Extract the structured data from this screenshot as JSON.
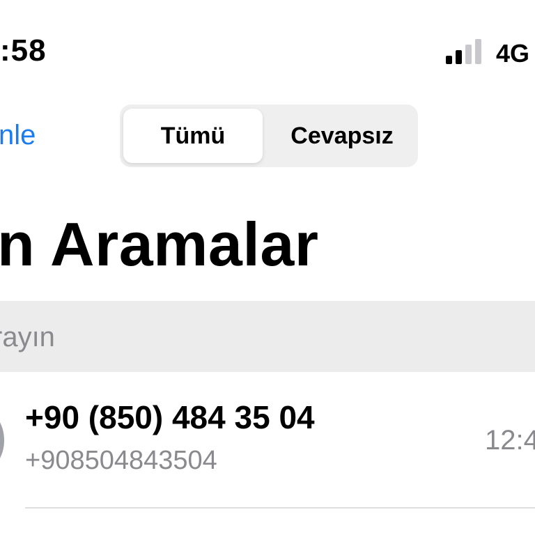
{
  "status_bar": {
    "time": ":58",
    "network": "4G",
    "signal_bars_active": 2,
    "signal_bars_total": 4
  },
  "nav": {
    "edit_label": "nle",
    "segments": [
      {
        "label": "Tümü",
        "selected": true
      },
      {
        "label": "Cevapsız",
        "selected": false
      }
    ]
  },
  "title": "n Aramalar",
  "search": {
    "placeholder": "rayın"
  },
  "calls": [
    {
      "name": "+90 (850) 484 35 04",
      "subtitle": "+908504843504",
      "time": "12:4"
    }
  ],
  "colors": {
    "accent": "#1a7cf0",
    "secondary_text": "#8a8a8e",
    "search_bg": "#ececec",
    "segment_bg": "#efeff0",
    "avatar": "#a1a1a8"
  }
}
